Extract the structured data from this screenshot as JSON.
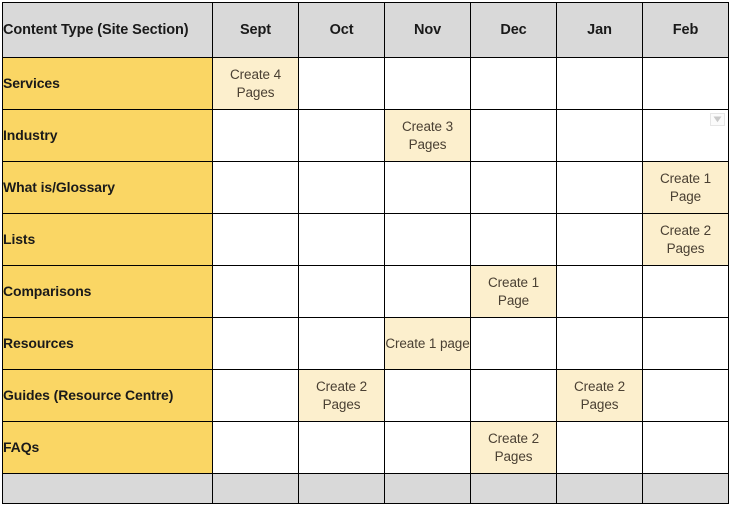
{
  "document": {
    "type": "content-calendar-table",
    "colors": {
      "header_gray": "#D9D9D9",
      "row_label_yellow": "#FAD664",
      "filled_cell_cream": "#FCEFCD",
      "grid_line": "#000000",
      "text_dark": "#1A1A1A",
      "cell_text": "#4A4033"
    }
  },
  "table": {
    "header": {
      "label_column": "Content Type (Site Section)",
      "months": [
        "Sept",
        "Oct",
        "Nov",
        "Dec",
        "Jan",
        "Feb"
      ]
    },
    "rows": [
      {
        "label": "Services",
        "cells": [
          "Create 4 Pages",
          "",
          "",
          "",
          "",
          ""
        ]
      },
      {
        "label": "Industry",
        "cells": [
          "",
          "",
          "Create 3 Pages",
          "",
          "",
          ""
        ]
      },
      {
        "label": "What is/Glossary",
        "cells": [
          "",
          "",
          "",
          "",
          "",
          "Create 1 Page"
        ]
      },
      {
        "label": "Lists",
        "cells": [
          "",
          "",
          "",
          "",
          "",
          "Create 2 Pages"
        ]
      },
      {
        "label": "Comparisons",
        "cells": [
          "",
          "",
          "",
          "Create 1 Page",
          "",
          ""
        ]
      },
      {
        "label": "Resources",
        "cells": [
          "",
          "",
          "Create 1 page",
          "",
          "",
          ""
        ]
      },
      {
        "label": "Guides (Resource Centre)",
        "cells": [
          "",
          "Create 2 Pages",
          "",
          "",
          "Create 2 Pages",
          ""
        ]
      },
      {
        "label": "FAQs",
        "cells": [
          "",
          "",
          "",
          "Create 2 Pages",
          "",
          ""
        ]
      }
    ],
    "footer_row": {
      "label": "",
      "cells": [
        "",
        "",
        "",
        "",
        "",
        ""
      ]
    }
  },
  "overlay": {
    "dropdown_button": {
      "icon": "chevron-down-icon",
      "row_index": 1,
      "column_index": 5
    }
  }
}
